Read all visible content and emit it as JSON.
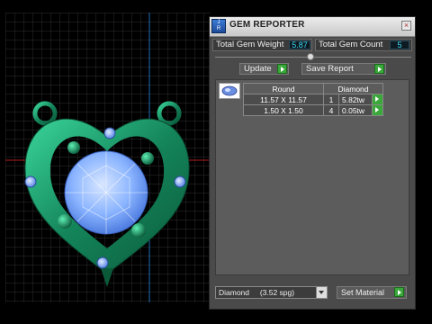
{
  "panel": {
    "title": "GEM REPORTER",
    "icon_name": "gem-reporter-icon",
    "total_gem_weight_label": "Total Gem Weight",
    "total_gem_weight_value": "5.87",
    "total_gem_count_label": "Total Gem Count",
    "total_gem_count_value": "5",
    "update_label": "Update",
    "save_report_label": "Save Report"
  },
  "table": {
    "headers": [
      "Round",
      "Diamond"
    ],
    "rows": [
      {
        "size": "11.57 X 11.57",
        "count": "1",
        "weight": "5.82tw"
      },
      {
        "size": "1.50 X 1.50",
        "count": "4",
        "weight": "0.05tw"
      }
    ]
  },
  "material": {
    "selected": "Diamond     (3.52 spg)",
    "set_label": "Set Material"
  },
  "colors": {
    "accent_green": "#3aa83a",
    "value_cyan": "#3fd6f0",
    "metal_green": "#1e8a5e",
    "gem_blue": "#8ab4ff"
  }
}
